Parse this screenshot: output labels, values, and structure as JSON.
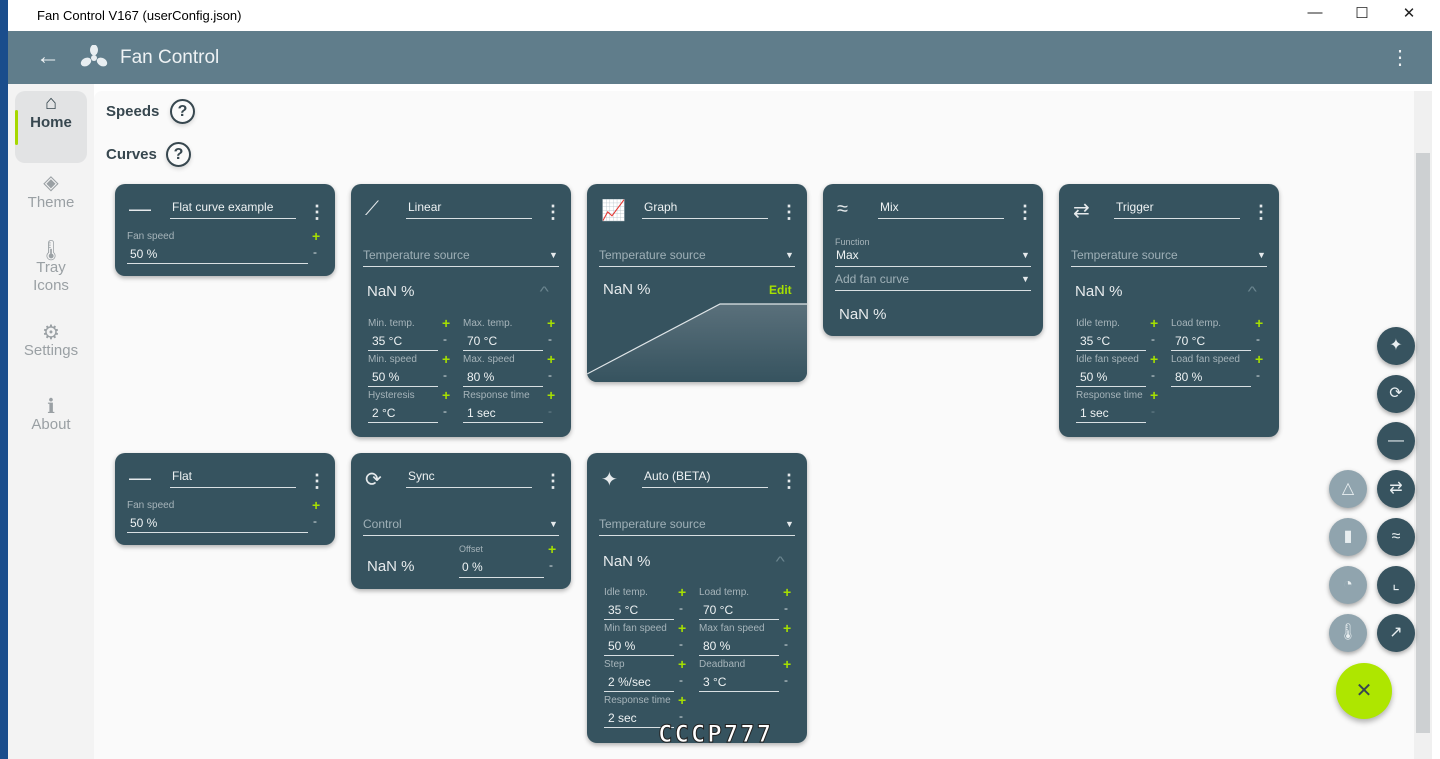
{
  "window": {
    "title": "Fan Control V167 (userConfig.json)",
    "minimize": "—",
    "maximize": "☐",
    "close": "✕"
  },
  "appbar": {
    "title": "Fan Control",
    "back": "←",
    "more": "⋮"
  },
  "sidebar": {
    "items": [
      {
        "label": "Home",
        "icon": "⌂",
        "active": true
      },
      {
        "label": "Theme",
        "icon": "◈"
      },
      {
        "label": "Tray Icons",
        "icon": "🌡"
      },
      {
        "label": "Settings",
        "icon": "⚙"
      },
      {
        "label": "About",
        "icon": "ℹ"
      }
    ]
  },
  "sections": {
    "speeds": "Speeds",
    "curves": "Curves",
    "help": "?"
  },
  "common": {
    "temp_source": "Temperature source",
    "nan": "NaN %",
    "plus": "+",
    "minus": "-",
    "menu": "⋮",
    "caret": "▼",
    "chevron": "^"
  },
  "cards": [
    {
      "type": "flat",
      "name": "Flat curve example",
      "label": "Fan speed",
      "value": "50 %"
    },
    {
      "type": "linear",
      "name": "Linear",
      "fields": [
        {
          "label": "Min. temp.",
          "value": "35 °C"
        },
        {
          "label": "Max. temp.",
          "value": "70 °C"
        },
        {
          "label": "Min. speed",
          "value": "50 %"
        },
        {
          "label": "Max. speed",
          "value": "80 %"
        },
        {
          "label": "Hysteresis",
          "value": "2 °C"
        },
        {
          "label": "Response time",
          "value": "1 sec",
          "minus_disabled": true
        }
      ]
    },
    {
      "type": "graph",
      "name": "Graph",
      "edit": "Edit"
    },
    {
      "type": "mix",
      "name": "Mix",
      "function_label": "Function",
      "function_value": "Max",
      "add_curve": "Add fan curve"
    },
    {
      "type": "trigger",
      "name": "Trigger",
      "fields": [
        {
          "label": "Idle temp.",
          "value": "35 °C"
        },
        {
          "label": "Load temp.",
          "value": "70 °C"
        },
        {
          "label": "Idle fan speed",
          "value": "50 %"
        },
        {
          "label": "Load fan speed",
          "value": "80 %"
        },
        {
          "label": "Response time",
          "value": "1 sec",
          "minus_disabled": true
        }
      ]
    },
    {
      "type": "flat",
      "name": "Flat",
      "label": "Fan speed",
      "value": "50 %"
    },
    {
      "type": "sync",
      "name": "Sync",
      "control": "Control",
      "offset_label": "Offset",
      "offset_value": "0 %"
    },
    {
      "type": "auto",
      "name": "Auto (BETA)",
      "fields": [
        {
          "label": "Idle temp.",
          "value": "35 °C"
        },
        {
          "label": "Load temp.",
          "value": "70 °C"
        },
        {
          "label": "Min fan speed",
          "value": "50 %"
        },
        {
          "label": "Max fan speed",
          "value": "80 %"
        },
        {
          "label": "Step",
          "value": "2 %/sec"
        },
        {
          "label": "Deadband",
          "value": "3 °C"
        },
        {
          "label": "Response time",
          "value": "2 sec"
        }
      ]
    }
  ],
  "fabs": [
    {
      "name": "add-auto",
      "icon": "✦"
    },
    {
      "name": "add-sync",
      "icon": "⟳"
    },
    {
      "name": "add-flat",
      "icon": "—"
    },
    {
      "name": "add-trigger",
      "icon": "⇄"
    },
    {
      "name": "add-mix",
      "icon": "≈"
    },
    {
      "name": "add-graph",
      "icon": "⌞"
    },
    {
      "name": "add-linear",
      "icon": "↗"
    },
    {
      "name": "add-sensor-delta",
      "icon": "△"
    },
    {
      "name": "add-sensor-file",
      "icon": "▮"
    },
    {
      "name": "add-sensor-time",
      "icon": "◔"
    },
    {
      "name": "add-sensor-temp",
      "icon": "🌡"
    }
  ],
  "close_fab": "✕",
  "watermark": "CCCP777",
  "colors": {
    "header": "#607d8b",
    "card": "#36535f",
    "accent": "#aee600"
  }
}
